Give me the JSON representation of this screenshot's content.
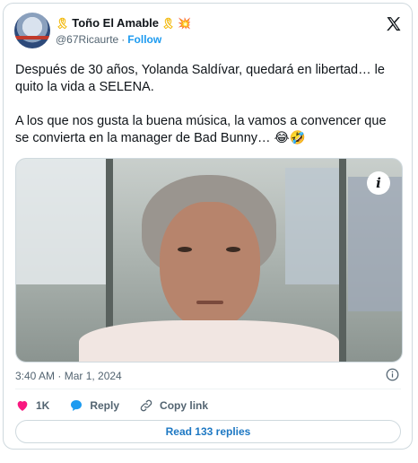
{
  "author": {
    "display_name": "Toño El Amable",
    "handle": "@67Ricaurte",
    "separator": "·",
    "follow_label": "Follow",
    "name_emoji_left": "🎗",
    "name_emoji_right_1": "🎗",
    "name_emoji_right_2": "💥"
  },
  "tweet": {
    "paragraph_1": "Después de 30 años, Yolanda Saldívar, quedará en libertad… le quito la vida a SELENA.",
    "paragraph_2": "A los que nos gusta la buena música,  la vamos a convencer que se convierta en la manager de Bad Bunny… 😂🤣",
    "media_info_label": "i",
    "timestamp": "3:40 AM · Mar 1, 2024"
  },
  "actions": {
    "like_count": "1K",
    "reply_label": "Reply",
    "copy_link_label": "Copy link"
  },
  "replies_button_label": "Read 133 replies",
  "colors": {
    "accent": "#1d9bf0",
    "like": "#f91880",
    "text_secondary": "#536471",
    "border": "#cfd9de"
  },
  "icons": {
    "brand": "x-logo-icon",
    "info": "info-icon",
    "like": "heart-icon",
    "reply": "speech-bubble-icon",
    "copy_link": "link-icon"
  }
}
